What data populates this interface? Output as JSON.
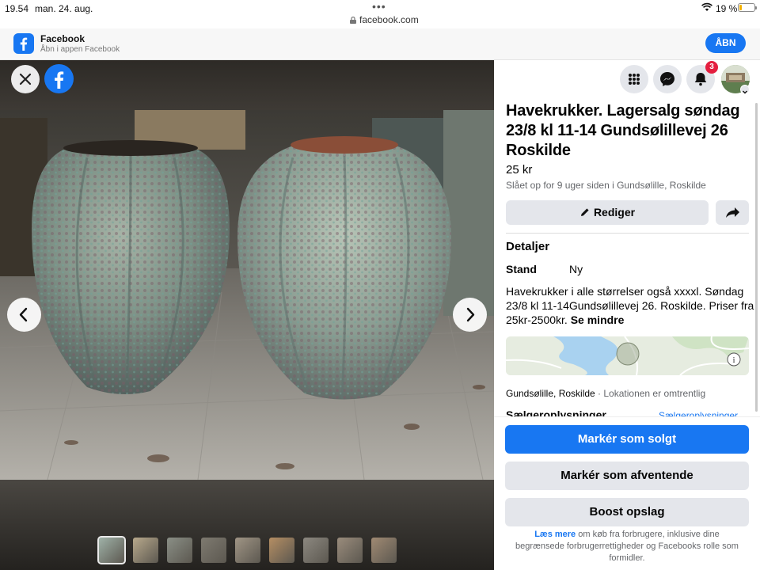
{
  "status_bar": {
    "time": "19.54",
    "date": "man. 24. aug.",
    "url": "facebook.com",
    "battery": "19 %",
    "battery_level": 0.19
  },
  "app_banner": {
    "title": "Facebook",
    "subtitle": "Åbn i appen Facebook",
    "open_label": "ÅBN"
  },
  "viewer": {
    "thumbnail_count": 9
  },
  "header": {
    "notification_count": "3"
  },
  "listing": {
    "title": "Havekrukker. Lagersalg søndag 23/8 kl 11-14 Gundsølillevej 26 Roskilde",
    "price": "25 kr",
    "listed": "Slået op for 9 uger siden i Gundsølille, Roskilde",
    "edit_label": "Rediger",
    "details_heading": "Detaljer",
    "condition_label": "Stand",
    "condition_value": "Ny",
    "description": "Havekrukker i alle størrelser også xxxxl. Søndag 23/8 kl 11-14Gundsølillevej 26. Roskilde. Priser fra 25kr-2500kr.",
    "see_less": "Se mindre",
    "location": "Gundsølille, Roskilde",
    "location_note": " · Lokationen er omtrentlig",
    "seller_heading": "Sælgeroplysninger",
    "seller_link": "Sælgeroplysninger"
  },
  "actions": {
    "mark_sold": "Markér som solgt",
    "mark_pending": "Markér som afventende",
    "boost": "Boost opslag",
    "footnote_link": "Læs mere",
    "footnote_text": " om køb fra forbrugere, inklusive dine begrænsede forbrugerrettigheder og Facebooks rolle som formidler."
  },
  "colors": {
    "brand_blue": "#1877f2",
    "badge_red": "#e41e3f",
    "button_gray": "#e4e6eb"
  }
}
